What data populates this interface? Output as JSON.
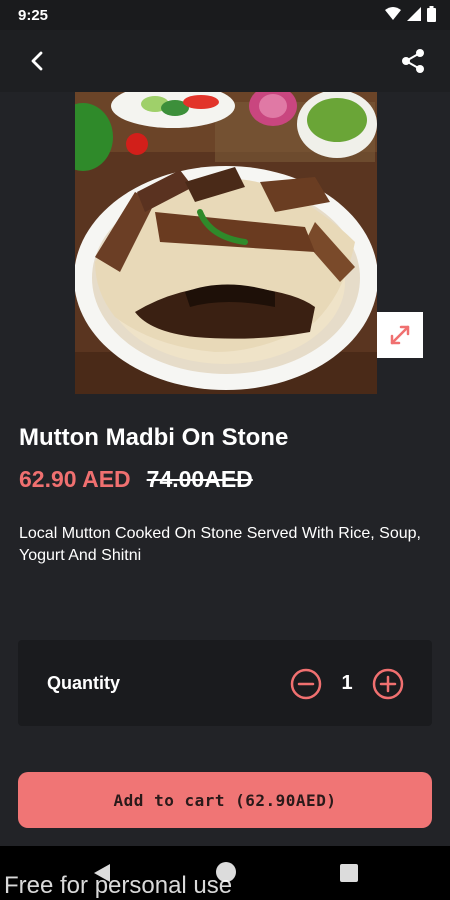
{
  "status_bar": {
    "time": "9:25",
    "icons": [
      "wifi-icon",
      "signal-icon",
      "battery-icon"
    ]
  },
  "app_bar": {
    "back_icon": "back-arrow-icon",
    "share_icon": "share-icon"
  },
  "product": {
    "title": "Mutton Madbi On Stone",
    "price": "62.90 AED",
    "old_price": "74.00AED",
    "description": "Local Mutton Cooked On Stone Served With Rice, Soup, Yogurt And Shitni",
    "expand_icon": "expand-icon"
  },
  "quantity": {
    "label": "Quantity",
    "value": "1",
    "minus_icon": "minus-circle-icon",
    "plus_icon": "plus-circle-icon"
  },
  "cart": {
    "button_label": "Add to cart (62.90AED)"
  },
  "nav_bar": {
    "icons": [
      "nav-back-icon",
      "nav-home-icon",
      "nav-recents-icon"
    ]
  },
  "watermark": "Free for personal use",
  "colors": {
    "accent": "#f07575",
    "background": "#222327",
    "card": "#1a1b1e"
  }
}
